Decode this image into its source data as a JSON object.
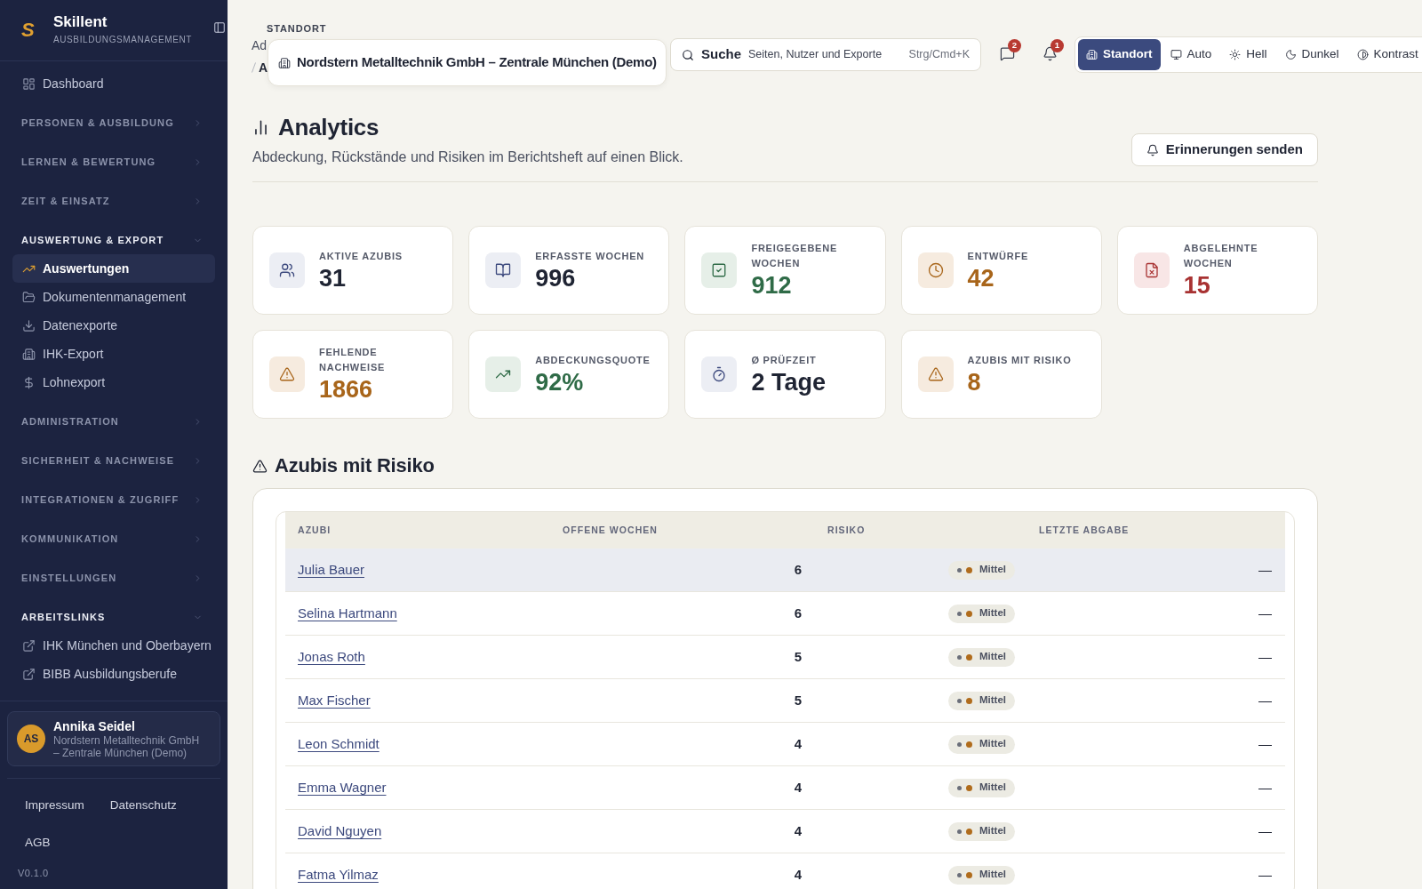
{
  "sidebar": {
    "brand": {
      "logo": "S",
      "name": "Skillent",
      "tagline": "AUSBILDUNGSMANAGEMENT"
    },
    "nav": [
      {
        "kind": "item",
        "label": "Dashboard",
        "selected": false
      },
      {
        "kind": "group",
        "label": "PERSONEN & AUSBILDUNG",
        "expanded": false
      },
      {
        "kind": "group",
        "label": "LERNEN & BEWERTUNG",
        "expanded": false
      },
      {
        "kind": "group",
        "label": "ZEIT & EINSATZ",
        "expanded": false
      },
      {
        "kind": "group",
        "label": "AUSWERTUNG & EXPORT",
        "expanded": true,
        "children": [
          {
            "kind": "page",
            "label": "Auswertungen",
            "selected": true
          },
          {
            "kind": "page",
            "label": "Dokumentenmanagement",
            "selected": false
          },
          {
            "kind": "page",
            "label": "Datenexporte",
            "selected": false
          },
          {
            "kind": "page",
            "label": "IHK-Export",
            "selected": false
          },
          {
            "kind": "page",
            "label": "Lohnexport",
            "selected": false
          }
        ]
      },
      {
        "kind": "group",
        "label": "ADMINISTRATION",
        "expanded": false
      },
      {
        "kind": "group",
        "label": "SICHERHEIT & NACHWEISE",
        "expanded": false
      },
      {
        "kind": "group",
        "label": "INTEGRATIONEN & ZUGRIFF",
        "expanded": false
      },
      {
        "kind": "group",
        "label": "KOMMUNIKATION",
        "expanded": false
      },
      {
        "kind": "group",
        "label": "EINSTELLUNGEN",
        "expanded": false
      },
      {
        "kind": "group",
        "label": "ARBEITSLINKS",
        "expanded": true,
        "children": [
          {
            "kind": "external",
            "label": "IHK München und Oberbayern",
            "selected": false
          },
          {
            "kind": "external",
            "label": "BIBB Ausbildungsberufe",
            "selected": false
          }
        ]
      }
    ],
    "user": {
      "initials": "AS",
      "name": "Annika Seidel",
      "organization": "Nordstern Metalltechnik GmbH – Zentrale München (Demo)"
    },
    "footer_links": [
      "Impressum",
      "Datenschutz",
      "AGB"
    ],
    "version": "V0.1.0"
  },
  "header": {
    "breadcrumbs": [
      {
        "label": "Ad",
        "current": false
      },
      {
        "label": "A",
        "current": true
      }
    ],
    "location": {
      "label": "STANDORT",
      "value": "Nordstern Metalltechnik GmbH – Zentrale München (Demo)"
    },
    "search": {
      "label": "Suche",
      "hint": "Seiten, Nutzer und Exporte",
      "shortcut": "Strg/Cmd+K"
    },
    "indicators": [
      {
        "kind": "messages",
        "count": "2"
      },
      {
        "kind": "alerts",
        "count": "1"
      }
    ],
    "theme_modes": [
      {
        "label": "Standort",
        "selected": true
      },
      {
        "label": "Auto",
        "selected": false
      },
      {
        "label": "Hell",
        "selected": false
      },
      {
        "label": "Dunkel",
        "selected": false
      },
      {
        "label": "Kontrast",
        "selected": false
      }
    ]
  },
  "page": {
    "title": "Analytics",
    "subtitle": "Abdeckung, Rückstände und Risiken im Berichtsheft auf einen Blick.",
    "action": "Erinnerungen senden"
  },
  "stats": [
    {
      "label": "AKTIVE AZUBIS",
      "value": "31",
      "kind": "neutral"
    },
    {
      "label": "ERFASSTE WOCHEN",
      "value": "996",
      "kind": "neutral"
    },
    {
      "label": "FREIGEGEBENE WOCHEN",
      "value": "912",
      "kind": "success"
    },
    {
      "label": "ENTWÜRFE",
      "value": "42",
      "kind": "warning"
    },
    {
      "label": "ABGELEHNTE WOCHEN",
      "value": "15",
      "kind": "danger"
    },
    {
      "label": "FEHLENDE NACHWEISE",
      "value": "1866",
      "kind": "warning"
    },
    {
      "label": "ABDECKUNGSQUOTE",
      "value": "92%",
      "kind": "success"
    },
    {
      "label": "Ø PRÜFZEIT",
      "value": "2 Tage",
      "kind": "neutral"
    },
    {
      "label": "AZUBIS MIT RISIKO",
      "value": "8",
      "kind": "warning"
    }
  ],
  "risk_table": {
    "title": "Azubis mit Risiko",
    "columns": [
      "AZUBI",
      "OFFENE WOCHEN",
      "RISIKO",
      "LETZTE ABGABE"
    ],
    "rows": [
      {
        "name": "Julia Bauer",
        "open_weeks": "6",
        "risk": {
          "label": "Mittel",
          "color": "#b06c1c"
        },
        "last_submission": "—",
        "highlighted": true
      },
      {
        "name": "Selina Hartmann",
        "open_weeks": "6",
        "risk": {
          "label": "Mittel",
          "color": "#b06c1c"
        },
        "last_submission": "—",
        "highlighted": false
      },
      {
        "name": "Jonas Roth",
        "open_weeks": "5",
        "risk": {
          "label": "Mittel",
          "color": "#b06c1c"
        },
        "last_submission": "—",
        "highlighted": false
      },
      {
        "name": "Max Fischer",
        "open_weeks": "5",
        "risk": {
          "label": "Mittel",
          "color": "#b06c1c"
        },
        "last_submission": "—",
        "highlighted": false
      },
      {
        "name": "Leon Schmidt",
        "open_weeks": "4",
        "risk": {
          "label": "Mittel",
          "color": "#b06c1c"
        },
        "last_submission": "—",
        "highlighted": false
      },
      {
        "name": "Emma Wagner",
        "open_weeks": "4",
        "risk": {
          "label": "Mittel",
          "color": "#b06c1c"
        },
        "last_submission": "—",
        "highlighted": false
      },
      {
        "name": "David Nguyen",
        "open_weeks": "4",
        "risk": {
          "label": "Mittel",
          "color": "#b06c1c"
        },
        "last_submission": "—",
        "highlighted": false
      },
      {
        "name": "Fatma Yilmaz",
        "open_weeks": "4",
        "risk": {
          "label": "Mittel",
          "color": "#b06c1c"
        },
        "last_submission": "—",
        "highlighted": false
      }
    ]
  }
}
